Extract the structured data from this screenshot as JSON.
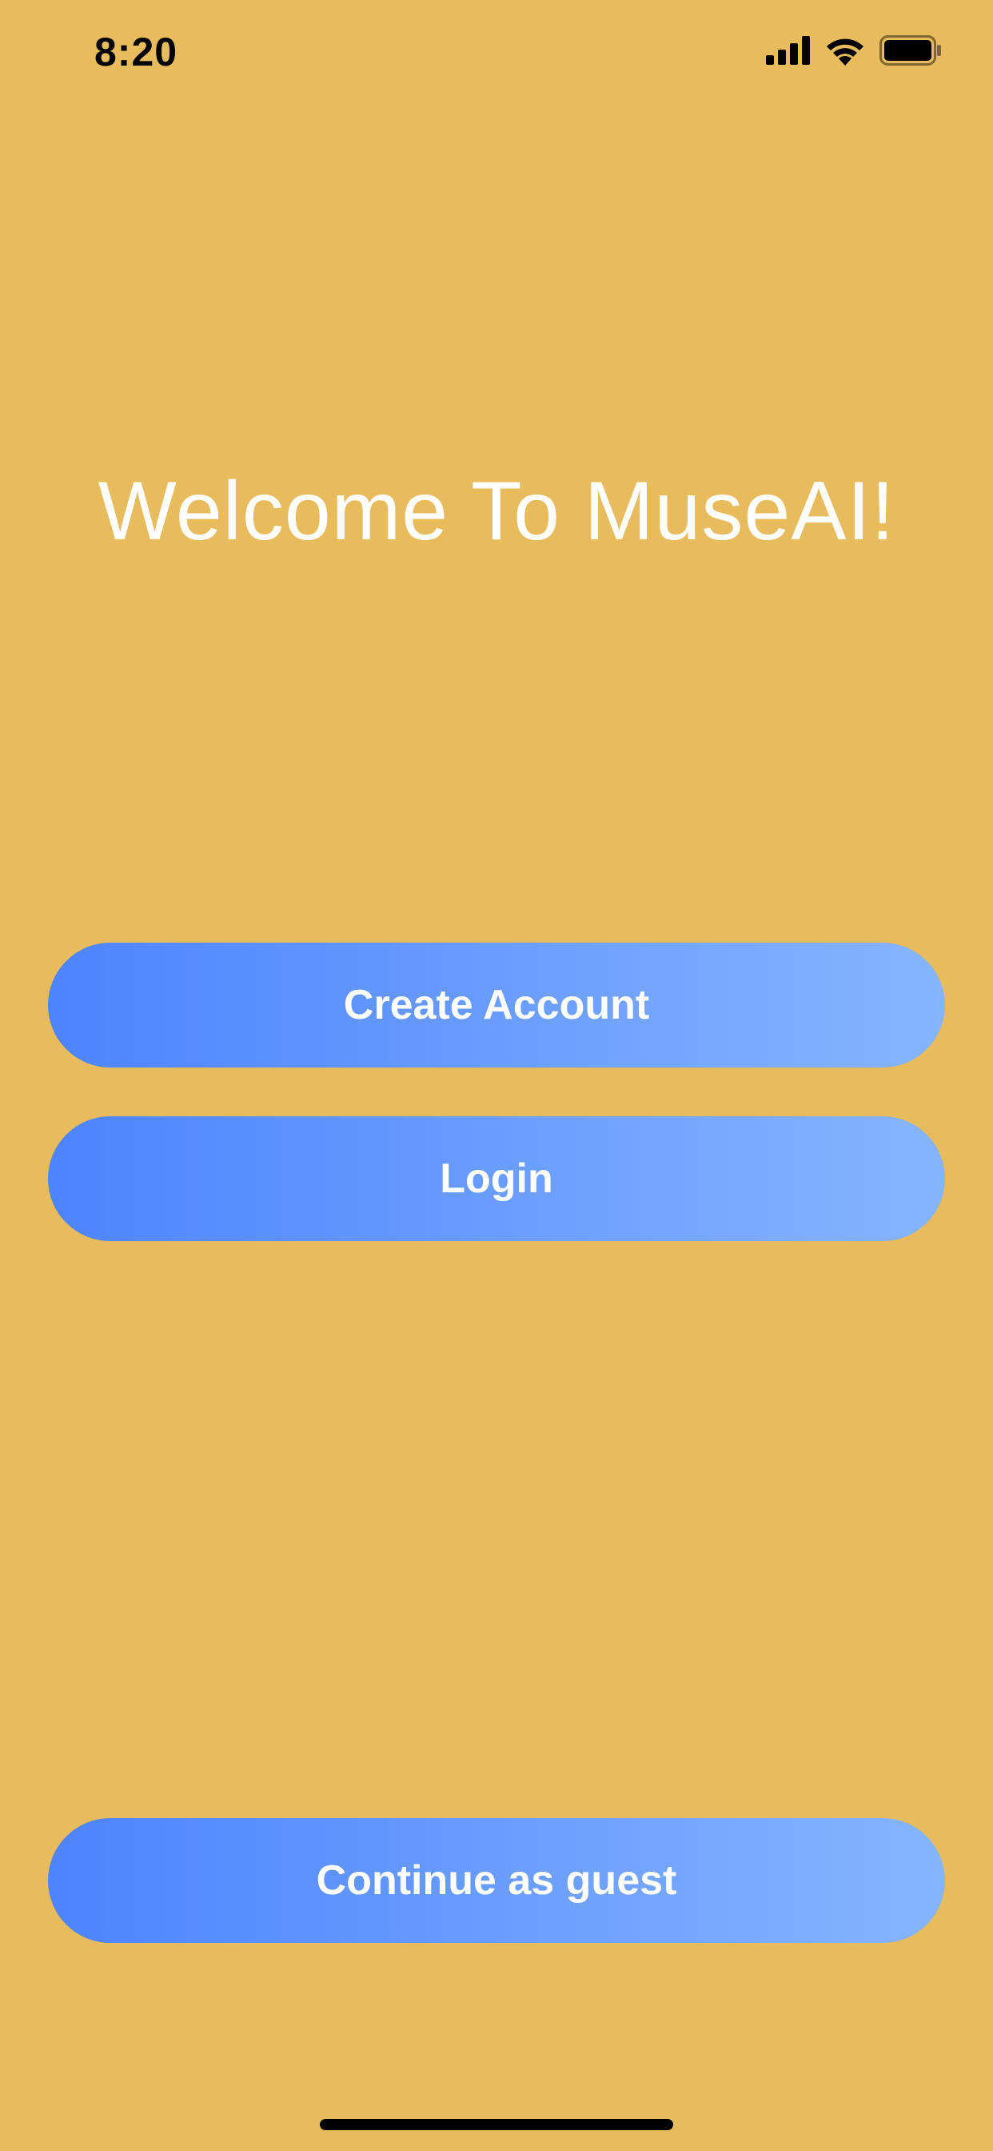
{
  "status_bar": {
    "time": "8:20",
    "icons": [
      "cellular-signal-icon",
      "wifi-icon",
      "battery-icon"
    ]
  },
  "welcome": {
    "title": "Welcome To MuseAI!"
  },
  "buttons": {
    "create_account": "Create Account",
    "login": "Login",
    "continue_as_guest": "Continue as guest"
  },
  "colors": {
    "background": "#E8BC5C",
    "button_gradient_start": "#4D84FF",
    "button_gradient_end": "#86B5FF",
    "button_text": "#FFFFFF",
    "title_text": "#FFFFFF"
  }
}
